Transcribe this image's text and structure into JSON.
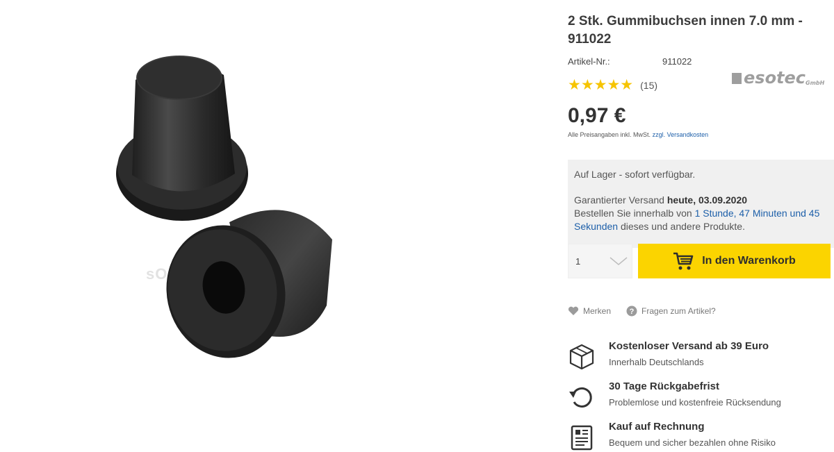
{
  "product": {
    "title": "2 Stk. Gummibuchsen innen 7.0 mm - 911022",
    "article_label": "Artikel-Nr.:",
    "article_number": "911022",
    "rating_stars": "★★★★★",
    "rating_value": 5,
    "review_count": "(15)",
    "brand": "esotec",
    "brand_suffix": "GmbH",
    "price": "0,97 €",
    "price_note_prefix": "Alle Preisangaben inkl. MwSt. ",
    "price_note_link": "zzgl. Versandkosten",
    "image_watermark": "sO",
    "image_icon": "rubber-bushing-image"
  },
  "delivery": {
    "availability": "Auf Lager - sofort verfügbar.",
    "guarantee_prefix": "Garantierter Versand ",
    "guarantee_date": "heute, 03.09.2020",
    "order_prefix": "Bestellen Sie innerhalb von ",
    "order_time": "1 Stunde, 47 Minuten und 45 Sekunden",
    "order_suffix": " dieses und andere Produkte."
  },
  "cart": {
    "quantity": "1",
    "button_label": "In den Warenkorb",
    "accent_color": "#fbd400"
  },
  "actions": {
    "wishlist": "Merken",
    "question": "Fragen zum Artikel?"
  },
  "benefits": [
    {
      "icon": "box-icon",
      "title": "Kostenloser Versand ab 39 Euro",
      "subtitle": "Innerhalb Deutschlands"
    },
    {
      "icon": "return-icon",
      "title": "30 Tage Rückgabefrist",
      "subtitle": "Problemlose und kostenfreie Rücksendung"
    },
    {
      "icon": "invoice-icon",
      "title": "Kauf auf Rechnung",
      "subtitle": "Bequem und sicher bezahlen ohne Risiko"
    }
  ]
}
